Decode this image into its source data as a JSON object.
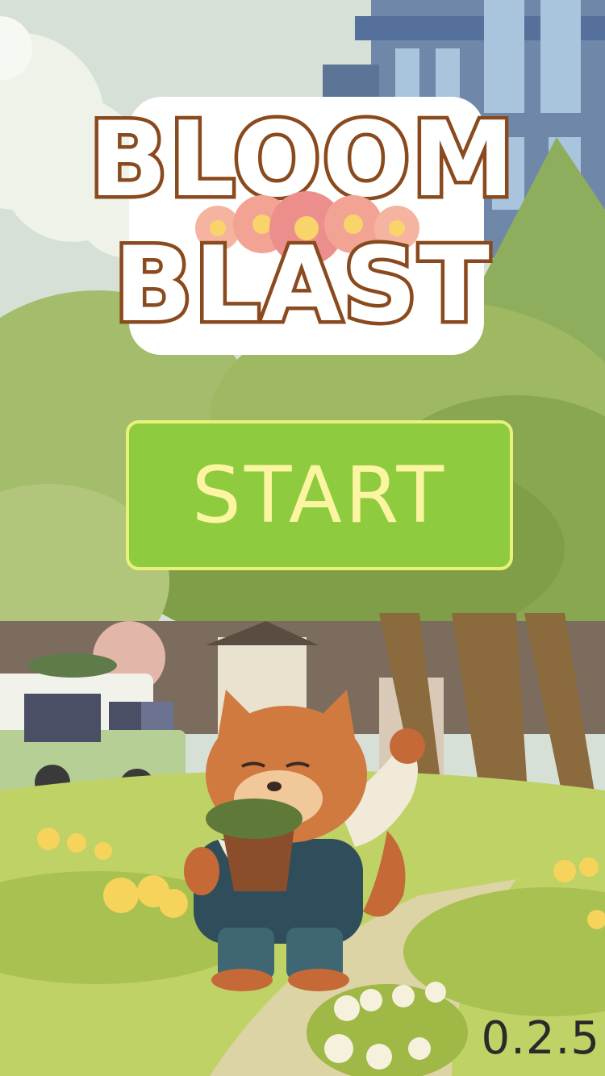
{
  "title": {
    "line1": "BLOOM",
    "line2": "BLAST"
  },
  "start_button": {
    "label": "START"
  },
  "version": "0.2.5",
  "colors": {
    "sky": "#d7e0d6",
    "button": "#8ecb3e",
    "button_border": "#e8f27a",
    "button_text": "#fbf5a2",
    "logo_fill": "#f7b545",
    "logo_outline": "#8a4a1f"
  },
  "icons": [
    "flower-icon",
    "fox-gardener-icon",
    "camper-van-icon",
    "tree-icon",
    "building-icon"
  ]
}
